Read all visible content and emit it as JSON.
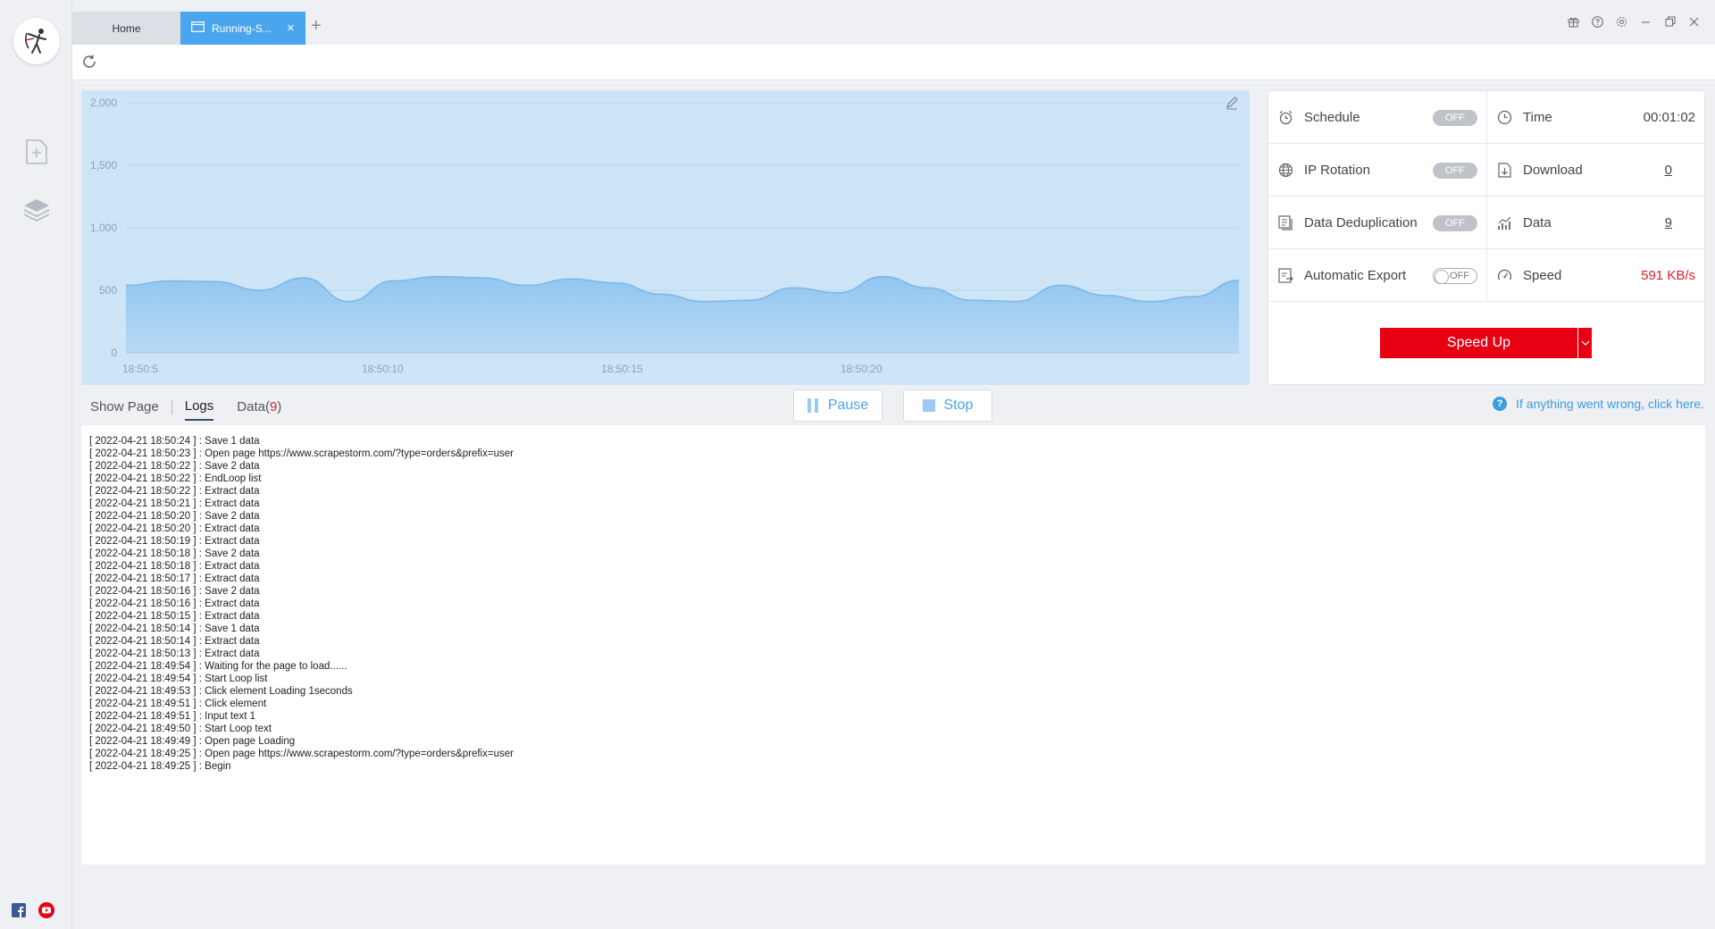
{
  "tabs": {
    "home_label": "Home",
    "running_label": "Running-S...",
    "add_label": "+",
    "close_label": "×"
  },
  "chart_data": {
    "type": "area",
    "x": [
      "18:50:5",
      "18:50:10",
      "18:50:15",
      "18:50:20"
    ],
    "xlabel": "",
    "ylabel": "",
    "yticks": [
      0,
      500,
      1000,
      1500,
      2000
    ],
    "ylim": [
      0,
      2000
    ],
    "series": [
      {
        "values": [
          540,
          575,
          570,
          500,
          600,
          410,
          575,
          610,
          600,
          540,
          590,
          560,
          470,
          410,
          420,
          520,
          480,
          610,
          520,
          420,
          410,
          540,
          460,
          410,
          450,
          580
        ]
      }
    ],
    "grid": true,
    "colors": {
      "fill": "#8fc4f0",
      "line": "#7ab6ea",
      "background": "#cde5f7"
    }
  },
  "stats": {
    "schedule": {
      "label": "Schedule",
      "state": "OFF"
    },
    "time": {
      "label": "Time",
      "value": "00:01:02"
    },
    "ip_rotation": {
      "label": "IP Rotation",
      "state": "OFF"
    },
    "download": {
      "label": "Download",
      "value": "0"
    },
    "dedup": {
      "label": "Data Deduplication",
      "state": "OFF"
    },
    "data": {
      "label": "Data",
      "value": "9"
    },
    "auto_export": {
      "label": "Automatic Export",
      "state": "OFF"
    },
    "speed": {
      "label": "Speed",
      "value": "591 KB/s"
    },
    "speed_up_label": "Speed Up"
  },
  "subtabs": {
    "show_page": "Show Page",
    "logs": "Logs",
    "data": "Data(",
    "data_count": "9",
    "data_close": ")"
  },
  "controls": {
    "pause": "Pause",
    "stop": "Stop"
  },
  "help_text": "If anything went wrong, click here.",
  "logs": [
    "[ 2022-04-21 18:50:24 ] : Save 1 data",
    "[ 2022-04-21 18:50:23 ] : Open page https://www.scrapestorm.com/?type=orders&prefix=user",
    "[ 2022-04-21 18:50:22 ] : Save 2 data",
    "[ 2022-04-21 18:50:22 ] : EndLoop list",
    "[ 2022-04-21 18:50:22 ] : Extract data",
    "[ 2022-04-21 18:50:21 ] : Extract data",
    "[ 2022-04-21 18:50:20 ] : Save 2 data",
    "[ 2022-04-21 18:50:20 ] : Extract data",
    "[ 2022-04-21 18:50:19 ] : Extract data",
    "[ 2022-04-21 18:50:18 ] : Save 2 data",
    "[ 2022-04-21 18:50:18 ] : Extract data",
    "[ 2022-04-21 18:50:17 ] : Extract data",
    "[ 2022-04-21 18:50:16 ] : Save 2 data",
    "[ 2022-04-21 18:50:16 ] : Extract data",
    "[ 2022-04-21 18:50:15 ] : Extract data",
    "[ 2022-04-21 18:50:14 ] : Save 1 data",
    "[ 2022-04-21 18:50:14 ] : Extract data",
    "[ 2022-04-21 18:50:13 ] : Extract data",
    "[ 2022-04-21 18:49:54 ] : Waiting for the page to load......",
    "[ 2022-04-21 18:49:54 ] : Start Loop list",
    "[ 2022-04-21 18:49:53 ] : Click element Loading 1seconds",
    "[ 2022-04-21 18:49:51 ] : Click element",
    "[ 2022-04-21 18:49:51 ] : Input text 1",
    "[ 2022-04-21 18:49:50 ] : Start Loop text",
    "[ 2022-04-21 18:49:49 ] : Open page Loading",
    "[ 2022-04-21 18:49:25 ] : Open page https://www.scrapestorm.com/?type=orders&prefix=user",
    "[ 2022-04-21 18:49:25 ] : Begin"
  ]
}
